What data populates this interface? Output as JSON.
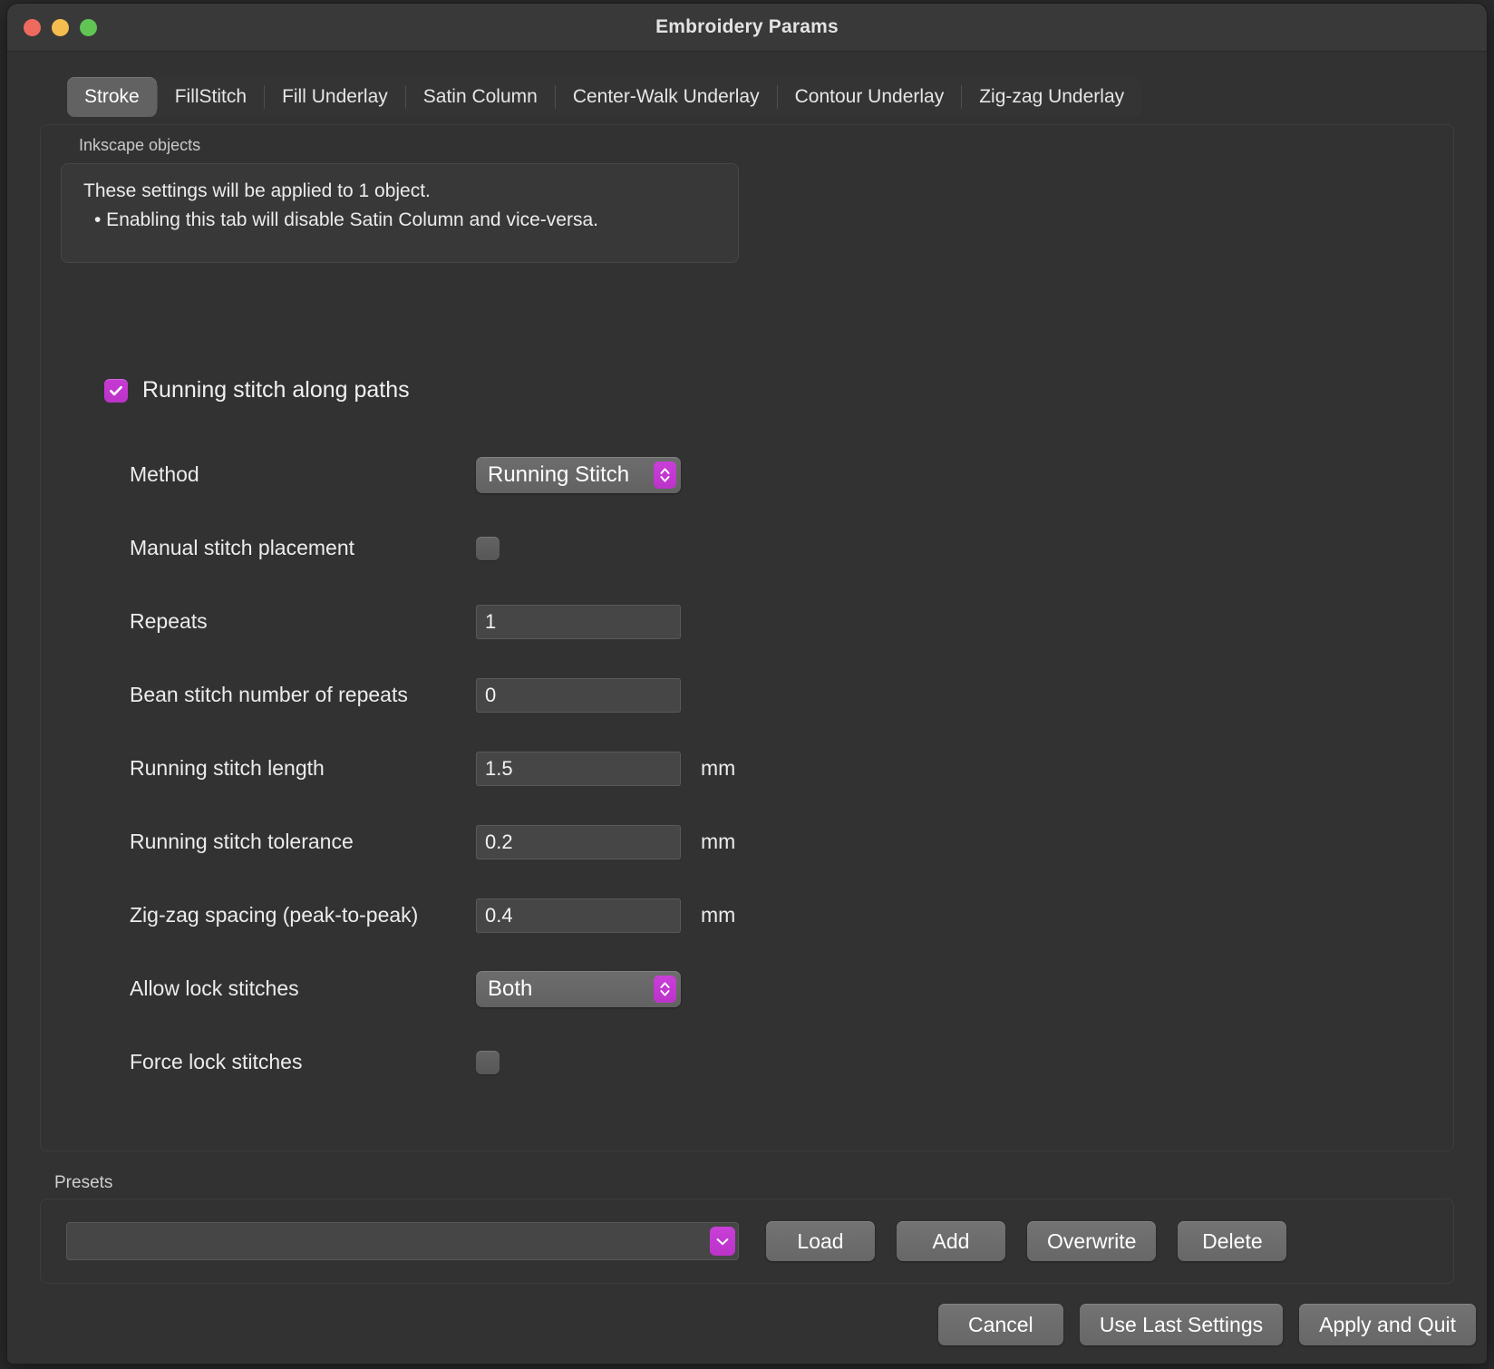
{
  "window": {
    "title": "Embroidery Params",
    "traffic_lights": [
      {
        "name": "close",
        "color": "#ee6a5f"
      },
      {
        "name": "minimize",
        "color": "#f5bd4f"
      },
      {
        "name": "zoom",
        "color": "#61c554"
      }
    ]
  },
  "tabs": [
    {
      "label": "Stroke",
      "active": true
    },
    {
      "label": "FillStitch",
      "active": false
    },
    {
      "label": "Fill Underlay",
      "active": false
    },
    {
      "label": "Satin Column",
      "active": false
    },
    {
      "label": "Center-Walk Underlay",
      "active": false
    },
    {
      "label": "Contour Underlay",
      "active": false
    },
    {
      "label": "Zig-zag Underlay",
      "active": false
    }
  ],
  "panel": {
    "group_label": "Inkscape objects",
    "info_line1": "These settings will be applied to 1 object.",
    "info_line2": "• Enabling this tab will disable Satin Column and vice-versa.",
    "enable_label": "Running stitch along paths",
    "enable_checked": true
  },
  "rows": [
    {
      "label": "Method",
      "type": "select",
      "value": "Running Stitch",
      "unit": ""
    },
    {
      "label": "Manual stitch placement",
      "type": "checkbox",
      "value": "",
      "checked": false,
      "unit": ""
    },
    {
      "label": "Repeats",
      "type": "entry",
      "value": "1",
      "unit": ""
    },
    {
      "label": "Bean stitch number of repeats",
      "type": "entry",
      "value": "0",
      "unit": ""
    },
    {
      "label": "Running stitch length",
      "type": "entry",
      "value": "1.5",
      "unit": "mm"
    },
    {
      "label": "Running stitch tolerance",
      "type": "entry",
      "value": "0.2",
      "unit": "mm"
    },
    {
      "label": "Zig-zag spacing (peak-to-peak)",
      "type": "entry",
      "value": "0.4",
      "unit": "mm"
    },
    {
      "label": "Allow lock stitches",
      "type": "select",
      "value": "Both",
      "unit": ""
    },
    {
      "label": "Force lock stitches",
      "type": "checkbox",
      "value": "",
      "checked": false,
      "unit": ""
    }
  ],
  "presets": {
    "label": "Presets",
    "combo_value": "",
    "combo_placeholder": "",
    "buttons": [
      {
        "label": "Load"
      },
      {
        "label": "Add"
      },
      {
        "label": "Overwrite"
      },
      {
        "label": "Delete"
      }
    ]
  },
  "footer": {
    "buttons": [
      {
        "label": "Cancel"
      },
      {
        "label": "Use Last Settings"
      },
      {
        "label": "Apply and Quit"
      }
    ]
  },
  "colors": {
    "accent": "#c93fd8",
    "window_bg": "#323232",
    "titlebar_bg": "#393939",
    "entry_bg": "#464646",
    "button_bg": "#6d6d6d",
    "text": "#ececec"
  }
}
